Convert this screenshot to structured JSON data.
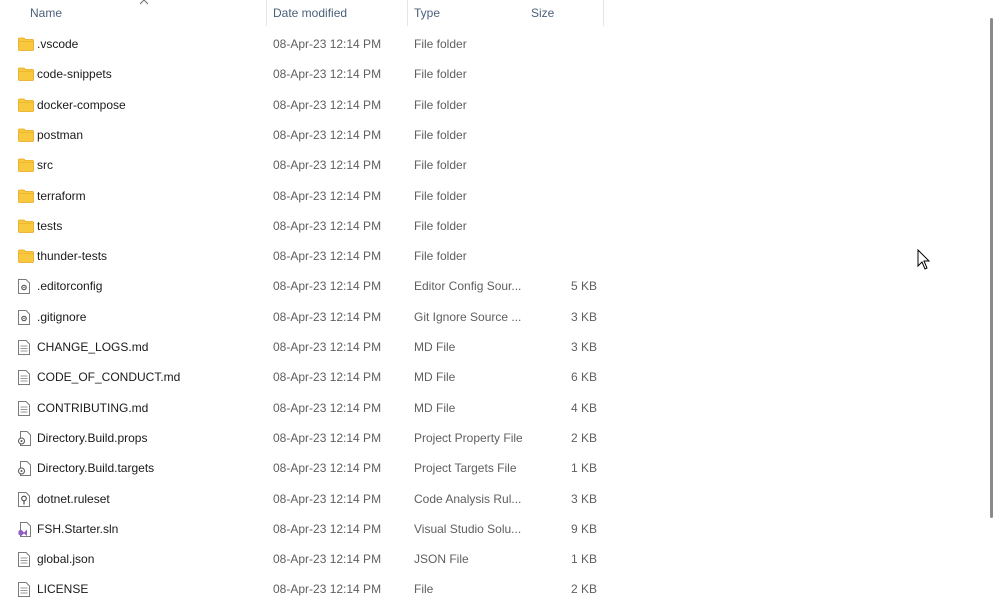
{
  "columns": {
    "name": "Name",
    "date": "Date modified",
    "type": "Type",
    "size": "Size"
  },
  "files": [
    {
      "icon": "folder-icon",
      "name": ".vscode",
      "date": "08-Apr-23 12:14 PM",
      "type": "File folder",
      "size": ""
    },
    {
      "icon": "folder-icon",
      "name": "code-snippets",
      "date": "08-Apr-23 12:14 PM",
      "type": "File folder",
      "size": ""
    },
    {
      "icon": "folder-icon",
      "name": "docker-compose",
      "date": "08-Apr-23 12:14 PM",
      "type": "File folder",
      "size": ""
    },
    {
      "icon": "folder-icon",
      "name": "postman",
      "date": "08-Apr-23 12:14 PM",
      "type": "File folder",
      "size": ""
    },
    {
      "icon": "folder-icon",
      "name": "src",
      "date": "08-Apr-23 12:14 PM",
      "type": "File folder",
      "size": ""
    },
    {
      "icon": "folder-icon",
      "name": "terraform",
      "date": "08-Apr-23 12:14 PM",
      "type": "File folder",
      "size": ""
    },
    {
      "icon": "folder-icon",
      "name": "tests",
      "date": "08-Apr-23 12:14 PM",
      "type": "File folder",
      "size": ""
    },
    {
      "icon": "folder-icon",
      "name": "thunder-tests",
      "date": "08-Apr-23 12:14 PM",
      "type": "File folder",
      "size": ""
    },
    {
      "icon": "config-file-icon",
      "name": ".editorconfig",
      "date": "08-Apr-23 12:14 PM",
      "type": "Editor Config Sour...",
      "size": "5 KB"
    },
    {
      "icon": "config-file-icon",
      "name": ".gitignore",
      "date": "08-Apr-23 12:14 PM",
      "type": "Git Ignore Source ...",
      "size": "3 KB"
    },
    {
      "icon": "document-file-icon",
      "name": "CHANGE_LOGS.md",
      "date": "08-Apr-23 12:14 PM",
      "type": "MD File",
      "size": "3 KB"
    },
    {
      "icon": "document-file-icon",
      "name": "CODE_OF_CONDUCT.md",
      "date": "08-Apr-23 12:14 PM",
      "type": "MD File",
      "size": "6 KB"
    },
    {
      "icon": "document-file-icon",
      "name": "CONTRIBUTING.md",
      "date": "08-Apr-23 12:14 PM",
      "type": "MD File",
      "size": "4 KB"
    },
    {
      "icon": "project-file-icon",
      "name": "Directory.Build.props",
      "date": "08-Apr-23 12:14 PM",
      "type": "Project Property File",
      "size": "2 KB"
    },
    {
      "icon": "project-file-icon",
      "name": "Directory.Build.targets",
      "date": "08-Apr-23 12:14 PM",
      "type": "Project Targets File",
      "size": "1 KB"
    },
    {
      "icon": "ruleset-file-icon",
      "name": "dotnet.ruleset",
      "date": "08-Apr-23 12:14 PM",
      "type": "Code Analysis Rul...",
      "size": "3 KB"
    },
    {
      "icon": "visual-studio-solution-icon",
      "name": "FSH.Starter.sln",
      "date": "08-Apr-23 12:14 PM",
      "type": "Visual Studio Solu...",
      "size": "9 KB"
    },
    {
      "icon": "document-file-icon",
      "name": "global.json",
      "date": "08-Apr-23 12:14 PM",
      "type": "JSON File",
      "size": "1 KB"
    },
    {
      "icon": "document-file-icon",
      "name": "LICENSE",
      "date": "08-Apr-23 12:14 PM",
      "type": "File",
      "size": "2 KB"
    }
  ],
  "colors": {
    "folder": "#f8c93e",
    "folder_dark": "#e8a81c",
    "header_text": "#4c607a",
    "vs_purple": "#8e5cc6"
  }
}
